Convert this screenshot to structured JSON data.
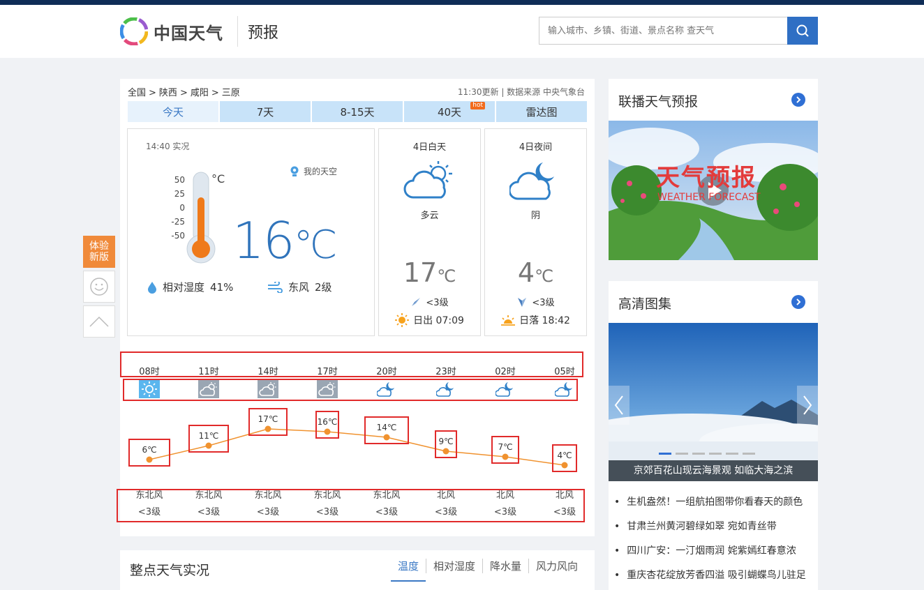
{
  "header": {
    "logo_text": "中国天气",
    "section": "预报",
    "search_placeholder": "输入城市、乡镇、街道、景点名称 查天气"
  },
  "breadcrumb": [
    "全国",
    ">",
    "陕西",
    ">",
    "咸阳",
    ">",
    "三原"
  ],
  "update_time": "11:30更新",
  "source": "数据来源 中央气象台",
  "tabs": [
    {
      "label": "今天",
      "active": true
    },
    {
      "label": "7天"
    },
    {
      "label": "8-15天"
    },
    {
      "label": "40天",
      "badge": "hot"
    },
    {
      "label": "雷达图"
    }
  ],
  "current": {
    "time": "14:40 实况",
    "my_sky": "我的天空",
    "scale": [
      "50",
      "25",
      "0",
      "-25",
      "-50"
    ],
    "unit": "°C",
    "temp": "16",
    "temp_unit": "℃",
    "humidity_label": "相对湿度",
    "humidity": "41%",
    "wind_dir": "东风",
    "wind_level": "2级"
  },
  "day": {
    "title": "4日白天",
    "desc": "多云",
    "temp": "17",
    "unit": "℃",
    "wind": "<3级",
    "sun": "日出 07:09"
  },
  "night": {
    "title": "4日夜间",
    "desc": "阴",
    "temp": "4",
    "unit": "℃",
    "wind": "<3级",
    "sun": "日落 18:42"
  },
  "chart_data": {
    "type": "line",
    "x": [
      "08时",
      "11时",
      "14时",
      "17时",
      "20时",
      "23时",
      "02时",
      "05时"
    ],
    "series": [
      {
        "values": [
          6,
          11,
          17,
          16,
          14,
          9,
          7,
          4
        ]
      }
    ],
    "labels": [
      "6℃",
      "11℃",
      "17℃",
      "16℃",
      "14℃",
      "9℃",
      "7℃",
      "4℃"
    ],
    "icons": [
      "sun-icon",
      "cloudy-day-icon",
      "cloudy-day-icon",
      "cloudy-day-icon",
      "cloudy-night-icon",
      "cloudy-night-icon",
      "cloudy-night-icon",
      "cloudy-night-icon"
    ],
    "wind_dir": [
      "东北风",
      "东北风",
      "东北风",
      "东北风",
      "东北风",
      "北风",
      "北风",
      "北风"
    ],
    "wind_level": [
      "<3级",
      "<3级",
      "<3级",
      "<3级",
      "<3级",
      "<3级",
      "<3级",
      "<3级"
    ],
    "color": "#f0922f"
  },
  "side": {
    "new_version": "体验\n新版"
  },
  "hourly": {
    "title": "整点天气实况",
    "tabs": [
      "温度",
      "相对湿度",
      "降水量",
      "风力风向"
    ]
  },
  "panel_video": {
    "title": "联播天气预报",
    "video_title": "天气预报",
    "video_sub": "WEATHER FORECAST"
  },
  "panel_gallery": {
    "title": "高清图集",
    "caption": "京郊百花山现云海景观 如临大海之滨",
    "news": [
      "生机盎然！一组航拍图带你看春天的颜色",
      "甘肃兰州黄河碧绿如翠 宛如青丝带",
      "四川广安：一汀烟雨润 姹紫嫣红春意浓",
      "重庆杏花绽放芳香四溢 吸引蝴蝶鸟儿驻足"
    ]
  },
  "colors": {
    "accent": "#3a78c4",
    "temp_blue": "#3074bb",
    "orange": "#f0922f",
    "annotation_red": "#e12a2a"
  }
}
